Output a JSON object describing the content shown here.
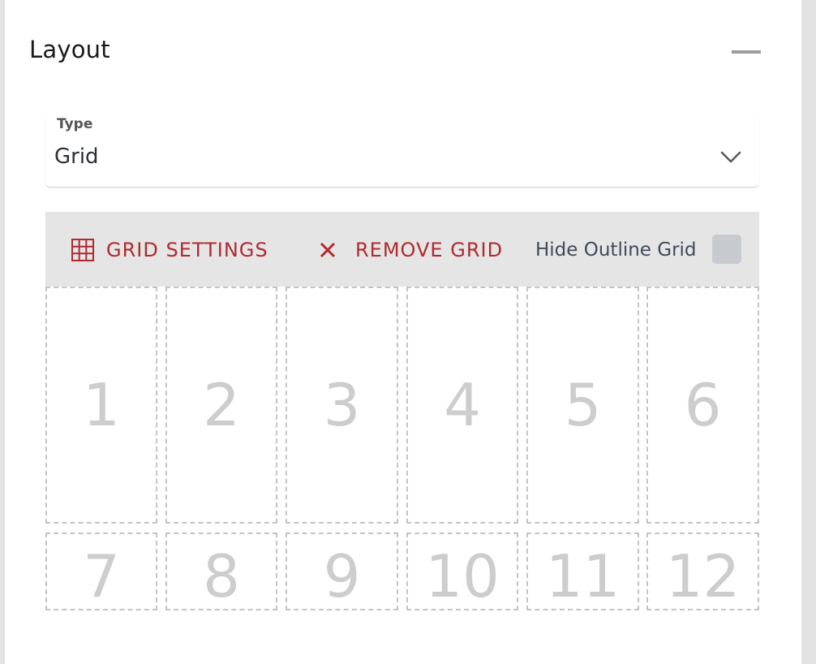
{
  "layout_section": {
    "title": "Layout",
    "collapse_icon": "minus-icon"
  },
  "type_field": {
    "label": "Type",
    "value": "Grid",
    "dropdown_icon": "chevron-down-icon"
  },
  "toolbar": {
    "grid_settings_label": "GRID SETTINGS",
    "grid_settings_icon": "grid-icon",
    "remove_grid_label": "REMOVE GRID",
    "remove_grid_icon": "close-icon",
    "hide_outline_label": "Hide Outline Grid",
    "hide_outline_checked": false,
    "accent_color": "#b02a30"
  },
  "grid": {
    "columns": 6,
    "cells": [
      "1",
      "2",
      "3",
      "4",
      "5",
      "6",
      "7",
      "8",
      "9",
      "10",
      "11",
      "12"
    ]
  }
}
